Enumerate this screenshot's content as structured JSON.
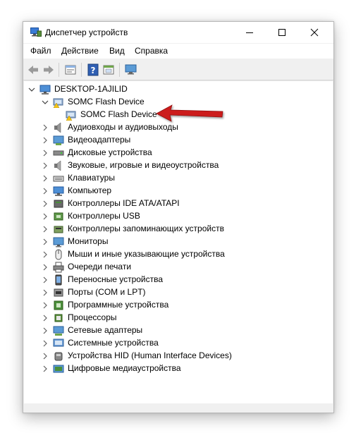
{
  "window": {
    "title": "Диспетчер устройств",
    "minimize_glyph": "—",
    "maximize_glyph": "☐",
    "close_glyph": "✕"
  },
  "menu": [
    "Файл",
    "Действие",
    "Вид",
    "Справка"
  ],
  "toolbar": {
    "buttons": [
      "back-arrow-icon",
      "forward-arrow-icon",
      "properties-icon",
      "help-icon",
      "view-icon",
      "monitor-scan-icon"
    ]
  },
  "tree": {
    "root": {
      "label": "DESKTOP-1AJILID",
      "icon": "computer-icon",
      "expanded": true
    },
    "somc_group": {
      "label": "SOMC Flash Device",
      "icon": "device-warning-icon",
      "expanded": true
    },
    "somc_device": {
      "label": "SOMC Flash Device",
      "icon": "device-warning-icon",
      "highlighted_by": "red-arrow"
    },
    "categories": [
      {
        "label": "Аудиовходы и аудиовыходы",
        "icon": "speaker-icon"
      },
      {
        "label": "Видеоадаптеры",
        "icon": "display-adapter-icon"
      },
      {
        "label": "Дисковые устройства",
        "icon": "disk-drive-icon"
      },
      {
        "label": "Звуковые, игровые и видеоустройства",
        "icon": "sound-icon"
      },
      {
        "label": "Клавиатуры",
        "icon": "keyboard-icon"
      },
      {
        "label": "Компьютер",
        "icon": "computer-icon"
      },
      {
        "label": "Контроллеры IDE ATA/ATAPI",
        "icon": "ide-icon"
      },
      {
        "label": "Контроллеры USB",
        "icon": "usb-icon"
      },
      {
        "label": "Контроллеры запоминающих устройств",
        "icon": "storage-controller-icon"
      },
      {
        "label": "Мониторы",
        "icon": "monitor-icon"
      },
      {
        "label": "Мыши и иные указывающие устройства",
        "icon": "mouse-icon"
      },
      {
        "label": "Очереди печати",
        "icon": "printer-icon"
      },
      {
        "label": "Переносные устройства",
        "icon": "portable-device-icon"
      },
      {
        "label": "Порты (COM и LPT)",
        "icon": "port-icon"
      },
      {
        "label": "Программные устройства",
        "icon": "software-device-icon"
      },
      {
        "label": "Процессоры",
        "icon": "processor-icon"
      },
      {
        "label": "Сетевые адаптеры",
        "icon": "network-icon"
      },
      {
        "label": "Системные устройства",
        "icon": "system-device-icon"
      },
      {
        "label": "Устройства HID (Human Interface Devices)",
        "icon": "hid-icon"
      },
      {
        "label": "Цифровые медиаустройства",
        "icon": "media-device-icon"
      }
    ]
  },
  "colors": {
    "window_bg": "#f0f0f0",
    "tree_bg": "#ffffff",
    "annotation_arrow": "#cc1f1f"
  }
}
